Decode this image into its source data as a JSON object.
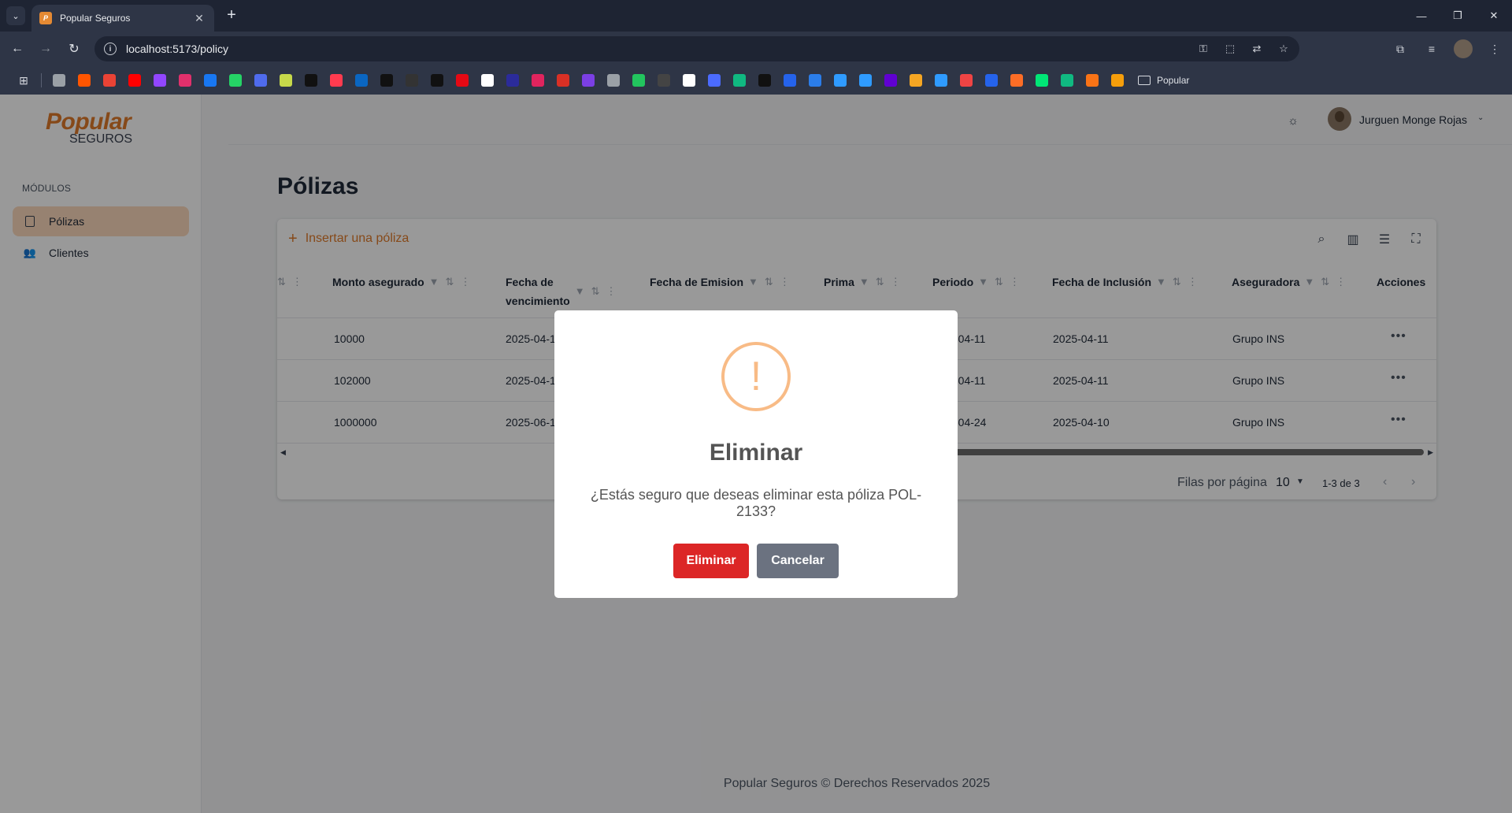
{
  "browser": {
    "tab_title": "Popular Seguros",
    "tab_close": "✕",
    "new_tab": "+",
    "url": "localhost:5173/policy",
    "bookmark_folder": "Popular",
    "bookmark_colors": [
      "#9aa0a6",
      "#ff5500",
      "#ea4335",
      "#ff0000",
      "#9146ff",
      "#e1306c",
      "#1877f2",
      "#25d366",
      "#4f6bed",
      "#c7d94a",
      "#111111",
      "#ff3b4f",
      "#0a66c2",
      "#111111",
      "#333333",
      "#111111",
      "#e50914",
      "#ffffff",
      "#2b2b9a",
      "#e0245e",
      "#d93025",
      "#7b3fe4",
      "#9aa0a6",
      "#22c55e",
      "#444444",
      "#ffffff",
      "#4b6bff",
      "#10b981",
      "#111111",
      "#2563eb",
      "#2b7de9",
      "#2f9bff",
      "#2f9bff",
      "#6001d2",
      "#f5a623",
      "#2f9bff",
      "#ef4444",
      "#2563eb",
      "#fc6d26",
      "#00e676",
      "#10b981",
      "#f97316",
      "#f59e0b"
    ]
  },
  "sidebar": {
    "logo_top": "Popular",
    "logo_bottom": "SEGUROS",
    "section_title": "MÓDULOS",
    "items": [
      {
        "label": "Pólizas",
        "active": true
      },
      {
        "label": "Clientes",
        "active": false
      }
    ]
  },
  "header": {
    "user_name": "Jurguen Monge Rojas"
  },
  "page": {
    "title": "Pólizas",
    "insert_label": "Insertar una póliza"
  },
  "table": {
    "columns": [
      "Monto asegurado",
      "Fecha de vencimiento",
      "Fecha de Emision",
      "Prima",
      "Periodo",
      "Fecha de Inclusión",
      "Aseguradora",
      "Acciones"
    ],
    "rows": [
      {
        "monto": "10000",
        "vencimiento": "2025-04-1",
        "periodo": "-04-11",
        "inclusion": "2025-04-11",
        "aseguradora": "Grupo INS"
      },
      {
        "monto": "102000",
        "vencimiento": "2025-04-1",
        "periodo": "-04-11",
        "inclusion": "2025-04-11",
        "aseguradora": "Grupo INS"
      },
      {
        "monto": "1000000",
        "vencimiento": "2025-06-1",
        "periodo": "-04-24",
        "inclusion": "2025-04-10",
        "aseguradora": "Grupo INS"
      }
    ]
  },
  "pagination": {
    "rows_label": "Filas por página",
    "rows_value": "10",
    "range": "1-3 de 3"
  },
  "footer": "Popular Seguros © Derechos Reservados 2025",
  "modal": {
    "title": "Eliminar",
    "text": "¿Estás seguro que deseas eliminar esta póliza POL-2133?",
    "confirm": "Eliminar",
    "cancel": "Cancelar",
    "icon_glyph": "!"
  }
}
